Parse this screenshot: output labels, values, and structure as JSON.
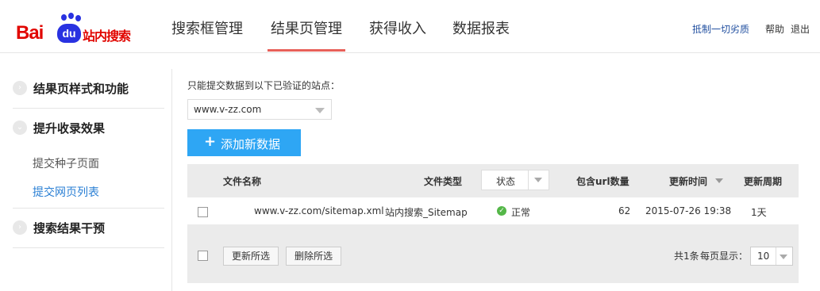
{
  "header": {
    "logo": {
      "latin_1": "Bai",
      "badge": "du",
      "product": "站内搜索"
    },
    "nav": [
      {
        "label": "搜索框管理"
      },
      {
        "label": "结果页管理",
        "active": true
      },
      {
        "label": "获得收入"
      },
      {
        "label": "数据报表"
      }
    ],
    "links": {
      "resist": "抵制一切劣质",
      "help": "帮助",
      "logout": "退出"
    }
  },
  "sidebar": {
    "sections": [
      {
        "title": "结果页样式和功能",
        "subitems": []
      },
      {
        "title": "提升收录效果",
        "subitems": [
          {
            "label": "提交种子页面"
          },
          {
            "label": "提交网页列表",
            "active": true
          }
        ]
      },
      {
        "title": "搜索结果干预",
        "subitems": []
      }
    ]
  },
  "main": {
    "prompt": "只能提交数据到以下已验证的站点：",
    "site_select": {
      "value": "www.v-zz.com"
    },
    "add_button": {
      "icon": "plus-icon",
      "label": "添加新数据"
    },
    "table": {
      "headers": {
        "file_name": "文件名称",
        "file_type": "文件类型",
        "status": "状态",
        "url_count": "包含url数量",
        "update_time": "更新时间",
        "update_period": "更新周期"
      },
      "rows": [
        {
          "file_name": "www.v-zz.com/sitemap.xml",
          "file_type": "站内搜索_Sitemap",
          "status": "正常",
          "url_count": "62",
          "update_time": "2015-07-26 19:38",
          "update_period": "1天"
        }
      ],
      "footer": {
        "update_selected": "更新所选",
        "delete_selected": "删除所选",
        "total": "共1条",
        "per_page_label": "每页显示：",
        "per_page_value": "10"
      }
    }
  },
  "colors": {
    "brand_red": "#e10601",
    "brand_blue": "#2932e1",
    "accent_blue": "#2ea6f4",
    "active_tab_underline": "#e8605a",
    "status_ok": "#54b748"
  }
}
